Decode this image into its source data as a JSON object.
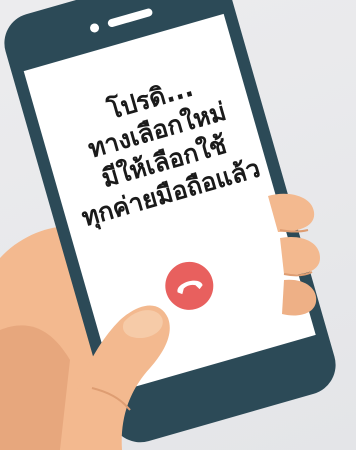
{
  "message": {
    "line1": "โปรดิ...",
    "line2": "ทางเลือกใหม่",
    "line3": "มีให้เลือกใช้",
    "line4": "ทุกค่ายมือถือแล้ว"
  },
  "icons": {
    "end_call": "phone-hangup-icon",
    "speaker": "speaker-slot-icon"
  },
  "colors": {
    "phone_body": "#2c4a57",
    "screen": "#ffffff",
    "hangup_button": "#e8605e",
    "skin": "#f3b98f",
    "skin_shadow": "#de9d72",
    "background": "#e8e9eb"
  }
}
